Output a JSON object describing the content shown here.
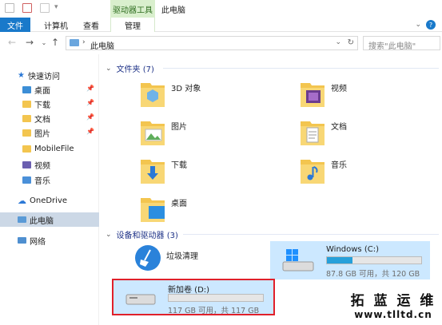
{
  "window": {
    "title": "此电脑",
    "context_tab": "驱动器工具"
  },
  "ribbon": {
    "tabs": [
      "文件",
      "计算机",
      "查看",
      "管理"
    ]
  },
  "address": {
    "path": "此电脑",
    "search_placeholder": "搜索\"此电脑\""
  },
  "sidebar": {
    "quick_access": "快速访问",
    "items": [
      {
        "label": "桌面",
        "pinned": true
      },
      {
        "label": "下载",
        "pinned": true
      },
      {
        "label": "文档",
        "pinned": true
      },
      {
        "label": "图片",
        "pinned": true
      },
      {
        "label": "MobileFile",
        "pinned": false
      },
      {
        "label": "视频",
        "pinned": false
      },
      {
        "label": "音乐",
        "pinned": false
      }
    ],
    "onedrive": "OneDrive",
    "this_pc": "此电脑",
    "network": "网络"
  },
  "folders": {
    "header": "文件夹 (7)",
    "items": [
      "3D 对象",
      "视频",
      "图片",
      "文档",
      "下载",
      "音乐",
      "桌面"
    ]
  },
  "devices": {
    "header": "设备和驱动器 (3)",
    "cleaner": "垃圾清理",
    "drives": [
      {
        "name": "Windows (C:)",
        "free_text": "87.8 GB 可用，共 120 GB",
        "used_fraction": 0.27
      },
      {
        "name": "新加卷 (D:)",
        "free_text": "117 GB 可用，共 117 GB",
        "used_fraction": 0.0
      }
    ]
  },
  "watermark": {
    "line1": "拓 蓝 运 维",
    "line2": "www.tlltd.cn"
  },
  "colors": {
    "accent": "#1979ca",
    "selection": "#cce8ff",
    "highlight_border": "#e0202a",
    "drive_fill": "#26a0da"
  }
}
